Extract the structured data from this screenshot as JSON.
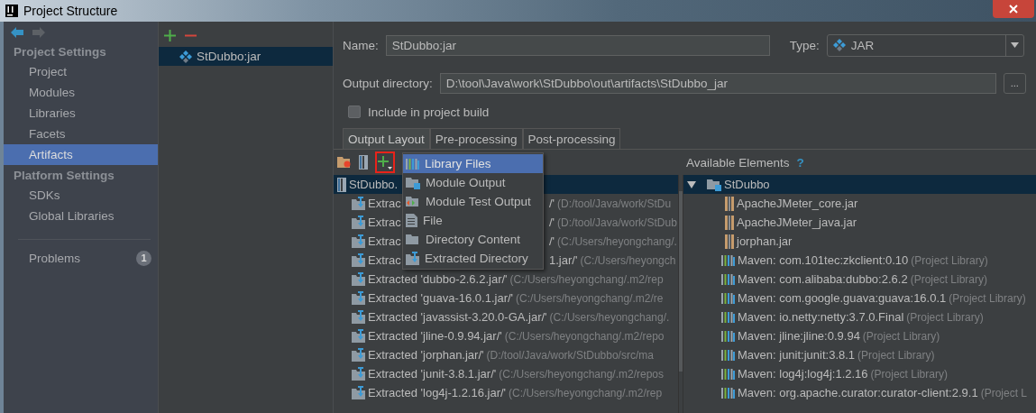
{
  "window": {
    "title": "Project Structure"
  },
  "nav_buttons": [
    {
      "kind": "back",
      "disabled": false
    },
    {
      "kind": "forward",
      "disabled": true
    }
  ],
  "sidebar": {
    "sections": [
      {
        "title": "Project Settings",
        "items": [
          {
            "label": "Project",
            "selected": false
          },
          {
            "label": "Modules",
            "selected": false
          },
          {
            "label": "Libraries",
            "selected": false
          },
          {
            "label": "Facets",
            "selected": false
          },
          {
            "label": "Artifacts",
            "selected": true
          }
        ]
      },
      {
        "title": "Platform Settings",
        "items": [
          {
            "label": "SDKs",
            "selected": false
          },
          {
            "label": "Global Libraries",
            "selected": false
          }
        ]
      }
    ],
    "problems": {
      "label": "Problems",
      "count": "1"
    }
  },
  "artifacts": [
    {
      "label": "StDubbo:jar",
      "selected": true
    }
  ],
  "form": {
    "name_label": "Name:",
    "name_value": "StDubbo:jar",
    "type_label": "Type:",
    "type_value": "JAR",
    "output_label": "Output directory:",
    "output_value": "D:\\tool\\Java\\work\\StDubbo\\out\\artifacts\\StDubbo_jar",
    "browse": "...",
    "include": {
      "label": "Include in project build",
      "checked": false
    }
  },
  "tabs": [
    {
      "label": "Output Layout",
      "selected": true
    },
    {
      "label": "Pre-processing",
      "selected": false
    },
    {
      "label": "Post-processing",
      "selected": false
    }
  ],
  "add_menu": [
    {
      "kind": "library",
      "label": "Library Files",
      "selected": true
    },
    {
      "kind": "module",
      "label": "Module Output",
      "selected": false
    },
    {
      "kind": "test",
      "label": "Module Test Output",
      "selected": false
    },
    {
      "kind": "file",
      "label": "File",
      "selected": false
    },
    {
      "kind": "folder",
      "label": "Directory Content",
      "selected": false
    },
    {
      "kind": "extracted",
      "label": "Extracted Directory",
      "selected": false
    }
  ],
  "layout_tree": {
    "label": "StDubbo.",
    "selected": true,
    "children": [
      {
        "label": "Extrac",
        "tail": "/'",
        "path": "(D:/tool/Java/work/StDu"
      },
      {
        "label": "Extrac",
        "tail": "/'",
        "path": "(D:/tool/Java/work/StDub"
      },
      {
        "label": "Extrac",
        "tail": "/'",
        "path": "(C:/Users/heyongchang/."
      },
      {
        "label": "Extrac",
        "tail": "1.jar/'",
        "path": "(C:/Users/heyongch"
      },
      {
        "label": "Extracted 'dubbo-2.6.2.jar/'",
        "path": "(C:/Users/heyongchang/.m2/rep"
      },
      {
        "label": "Extracted 'guava-16.0.1.jar/'",
        "path": "(C:/Users/heyongchang/.m2/re"
      },
      {
        "label": "Extracted 'javassist-3.20.0-GA.jar/'",
        "path": "(C:/Users/heyongchang/."
      },
      {
        "label": "Extracted 'jline-0.9.94.jar/'",
        "path": "(C:/Users/heyongchang/.m2/repo"
      },
      {
        "label": "Extracted 'jorphan.jar/'",
        "path": "(D:/tool/Java/work/StDubbo/src/ma"
      },
      {
        "label": "Extracted 'junit-3.8.1.jar/'",
        "path": "(C:/Users/heyongchang/.m2/repos"
      },
      {
        "label": "Extracted 'log4j-1.2.16.jar/'",
        "path": "(C:/Users/heyongchang/.m2/rep"
      }
    ]
  },
  "available": {
    "title": "Available Elements",
    "help": "?",
    "tree": {
      "label": "StDubbo",
      "expanded": true,
      "selected": true,
      "children": [
        {
          "kind": "jar",
          "label": "ApacheJMeter_core.jar"
        },
        {
          "kind": "jar",
          "label": "ApacheJMeter_java.jar"
        },
        {
          "kind": "jar",
          "label": "jorphan.jar"
        },
        {
          "kind": "library",
          "label": "Maven: com.101tec:zkclient:0.10",
          "note": "(Project Library)"
        },
        {
          "kind": "library",
          "label": "Maven: com.alibaba:dubbo:2.6.2",
          "note": "(Project Library)"
        },
        {
          "kind": "library",
          "label": "Maven: com.google.guava:guava:16.0.1",
          "note": "(Project Library)"
        },
        {
          "kind": "library",
          "label": "Maven: io.netty:netty:3.7.0.Final",
          "note": "(Project Library)"
        },
        {
          "kind": "library",
          "label": "Maven: jline:jline:0.9.94",
          "note": "(Project Library)"
        },
        {
          "kind": "library",
          "label": "Maven: junit:junit:3.8.1",
          "note": "(Project Library)"
        },
        {
          "kind": "library",
          "label": "Maven: log4j:log4j:1.2.16",
          "note": "(Project Library)"
        },
        {
          "kind": "library",
          "label": "Maven: org.apache.curator:curator-client:2.9.1",
          "note": "(Project L"
        }
      ]
    }
  }
}
